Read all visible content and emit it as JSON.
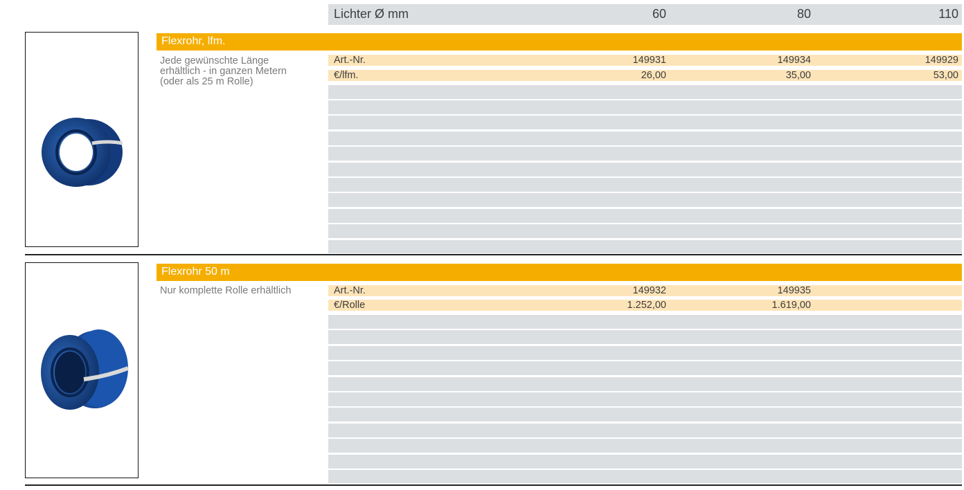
{
  "header": {
    "label": "Lichter Ø mm",
    "columns": [
      "60",
      "80",
      "110"
    ]
  },
  "sections": [
    {
      "title": "Flexrohr, lfm.",
      "description": [
        "Jede gewünschte Länge",
        "erhältlich - in ganzen Metern",
        "(oder als 25 m Rolle)"
      ],
      "rows": [
        {
          "label": "Art.-Nr.",
          "values": [
            "149931",
            "149934",
            "149929"
          ]
        },
        {
          "label": "€/lfm.",
          "values": [
            "26,00",
            "35,00",
            "53,00"
          ]
        }
      ]
    },
    {
      "title": "Flexrohr 50 m",
      "description": [
        "Nur komplette Rolle erhältlich"
      ],
      "rows": [
        {
          "label": "Art.-Nr.",
          "values": [
            "149932",
            "149935",
            ""
          ]
        },
        {
          "label": "€/Rolle",
          "values": [
            "1.252,00",
            "1.619,00",
            ""
          ]
        }
      ]
    }
  ],
  "colors": {
    "accent": "#f5ae00",
    "row_highlight": "#fde4b8",
    "grey_band": "#dcdfe2",
    "pipe_blue": "#1f4f9a"
  },
  "icons": [
    "flexible-pipe-coil-image",
    "flexible-pipe-roll-image"
  ]
}
